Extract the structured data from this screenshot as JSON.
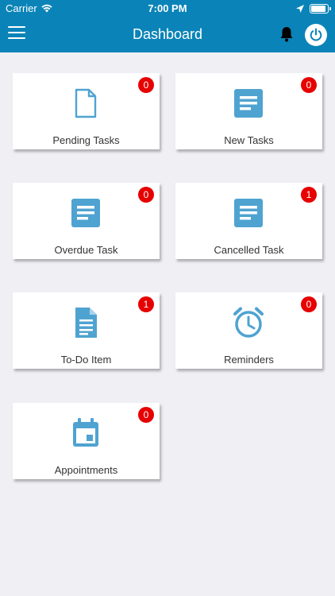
{
  "status_bar": {
    "carrier": "Carrier",
    "time": "7:00 PM"
  },
  "nav": {
    "title": "Dashboard"
  },
  "colors": {
    "header": "#0a84b8",
    "icon": "#4fa3d1",
    "badge": "#e60000"
  },
  "tiles": [
    {
      "label": "Pending Tasks",
      "badge": "0",
      "icon": "document-outline-icon"
    },
    {
      "label": "New Tasks",
      "badge": "0",
      "icon": "list-card-icon"
    },
    {
      "label": "Overdue Task",
      "badge": "0",
      "icon": "list-card-icon"
    },
    {
      "label": "Cancelled Task",
      "badge": "1",
      "icon": "list-card-icon"
    },
    {
      "label": "To-Do Item",
      "badge": "1",
      "icon": "document-lines-icon"
    },
    {
      "label": "Reminders",
      "badge": "0",
      "icon": "alarm-clock-icon"
    },
    {
      "label": "Appointments",
      "badge": "0",
      "icon": "calendar-icon"
    }
  ]
}
